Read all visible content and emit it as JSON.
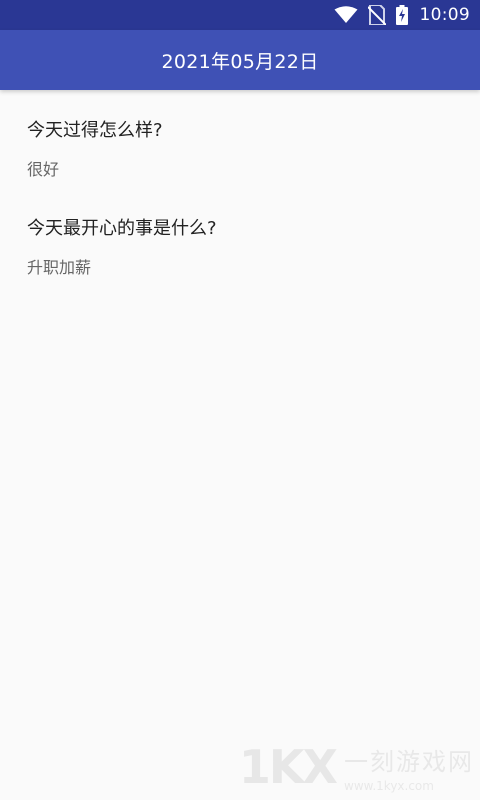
{
  "status_bar": {
    "icons": [
      "wifi-icon",
      "no-sim-icon",
      "battery-charging-icon"
    ],
    "time": "10:09"
  },
  "app_bar": {
    "title": "2021年05月22日"
  },
  "entries": [
    {
      "question": "今天过得怎么样?",
      "answer": "很好"
    },
    {
      "question": "今天最开心的事是什么?",
      "answer": "升职加薪"
    }
  ],
  "watermark": {
    "logo": "1KX",
    "text": "一刻游戏网",
    "url": "www.1kyx.com"
  },
  "colors": {
    "status_bar": "#2a3794",
    "app_bar": "#3f51b5",
    "background": "#fafafa"
  }
}
